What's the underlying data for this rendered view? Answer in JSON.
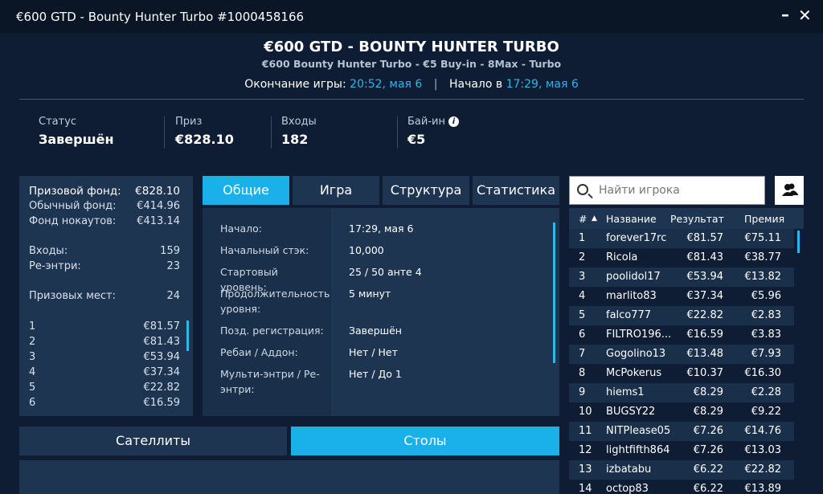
{
  "window": {
    "title": "€600 GTD - Bounty Hunter Turbo #1000458166",
    "minimize": "–",
    "close": "✕"
  },
  "header": {
    "title": "€600 GTD - BOUNTY HUNTER TURBO",
    "subtitle": "€600 Bounty Hunter Turbo - €5 Buy-in - 8Max - Turbo",
    "end_label": "Окончание игры:",
    "end_time": "20:52, мая 6",
    "separator": "|",
    "start_label": "Начало в",
    "start_time": "17:29, мая 6"
  },
  "stats": [
    {
      "label": "Статус",
      "value": "Завершён"
    },
    {
      "label": "Приз",
      "value": "€828.10"
    },
    {
      "label": "Входы",
      "value": "182"
    },
    {
      "label": "Бай-ин",
      "value": "€5",
      "info": "i"
    }
  ],
  "prize_panel": {
    "fund_label": "Призовой фонд:",
    "fund_value": "€828.10",
    "regular_label": "Обычный фонд:",
    "regular_value": "€414.96",
    "ko_label": "Фонд нокаутов:",
    "ko_value": "€413.14",
    "entries_label": "Входы:",
    "entries_value": "159",
    "reentries_label": "Ре-энтри:",
    "reentries_value": "23",
    "places_label": "Призовых мест:",
    "places_value": "24",
    "payouts": [
      {
        "place": "1",
        "amount": "€81.57"
      },
      {
        "place": "2",
        "amount": "€81.43"
      },
      {
        "place": "3",
        "amount": "€53.94"
      },
      {
        "place": "4",
        "amount": "€37.34"
      },
      {
        "place": "5",
        "amount": "€22.82"
      },
      {
        "place": "6",
        "amount": "€16.59"
      }
    ]
  },
  "tabs": [
    {
      "label": "Общие",
      "active": true
    },
    {
      "label": "Игра",
      "active": false
    },
    {
      "label": "Структура",
      "active": false
    },
    {
      "label": "Статистика",
      "active": false
    }
  ],
  "general": [
    {
      "key": "Начало:",
      "value": "17:29, мая 6"
    },
    {
      "key": "Начальный стэк:",
      "value": "10,000"
    },
    {
      "key": "Стартовый уровень:",
      "value": "25 / 50 анте 4"
    },
    {
      "key": "Продолжительность уровня:",
      "value": "5 минут"
    },
    {
      "key": "Позд. регистрация:",
      "value": "Завершён"
    },
    {
      "key": "Ребаи / Аддон:",
      "value": "Нет / Нет"
    },
    {
      "key": "Мульти-энтри / Ре-энтри:",
      "value": "Нет / До 1"
    }
  ],
  "bottom_buttons": {
    "satellites": "Сателлиты",
    "tables": "Столы"
  },
  "search": {
    "placeholder": "Найти игрока"
  },
  "players_table": {
    "headers": {
      "num": "#",
      "sort": "▲",
      "name": "Название",
      "result": "Результат",
      "prize": "Премия"
    },
    "rows": [
      {
        "n": "1",
        "name": "forever17rc",
        "result": "€81.57",
        "prize": "€75.11"
      },
      {
        "n": "2",
        "name": "Ricola",
        "result": "€81.43",
        "prize": "€38.77"
      },
      {
        "n": "3",
        "name": "poolidol17",
        "result": "€53.94",
        "prize": "€13.82"
      },
      {
        "n": "4",
        "name": "marlito83",
        "result": "€37.34",
        "prize": "€5.96"
      },
      {
        "n": "5",
        "name": "falco777",
        "result": "€22.82",
        "prize": "€2.83"
      },
      {
        "n": "6",
        "name": "FILTRO196...",
        "result": "€16.59",
        "prize": "€3.83"
      },
      {
        "n": "7",
        "name": "Gogolino13",
        "result": "€13.48",
        "prize": "€7.93"
      },
      {
        "n": "8",
        "name": "McPokerus",
        "result": "€10.37",
        "prize": "€16.30"
      },
      {
        "n": "9",
        "name": "hiems1",
        "result": "€8.29",
        "prize": "€2.28"
      },
      {
        "n": "10",
        "name": "BUGSY22",
        "result": "€8.29",
        "prize": "€9.22"
      },
      {
        "n": "11",
        "name": "NITPlease05",
        "result": "€7.26",
        "prize": "€14.76"
      },
      {
        "n": "12",
        "name": "lightfifth864",
        "result": "€7.26",
        "prize": "€13.03"
      },
      {
        "n": "13",
        "name": "izbatabu",
        "result": "€6.22",
        "prize": "€22.82"
      },
      {
        "n": "14",
        "name": "octop83",
        "result": "€6.22",
        "prize": "€13.89"
      }
    ]
  }
}
